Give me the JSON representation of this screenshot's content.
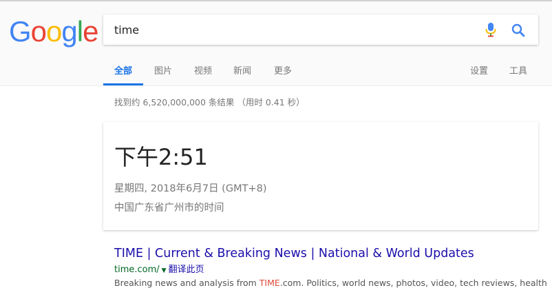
{
  "logo": {
    "letters": [
      {
        "char": "G",
        "color": "#4285F4"
      },
      {
        "char": "o",
        "color": "#EA4335"
      },
      {
        "char": "o",
        "color": "#FBBC05"
      },
      {
        "char": "g",
        "color": "#4285F4"
      },
      {
        "char": "l",
        "color": "#34A853"
      },
      {
        "char": "e",
        "color": "#EA4335"
      }
    ]
  },
  "search": {
    "query": "time"
  },
  "tabs": {
    "all": "全部",
    "images": "图片",
    "videos": "视频",
    "news": "新闻",
    "more": "更多",
    "settings": "设置",
    "tools": "工具"
  },
  "stats": {
    "text": "找到约 6,520,000,000 条结果 （用时 0.41 秒）"
  },
  "time_card": {
    "time": "下午2:51",
    "date": "星期四, 2018年6月7日 (GMT+8)",
    "location": "中国广东省广州市的时间"
  },
  "result": {
    "title": "TIME | Current & Breaking News | National & World Updates",
    "url": "time.com/",
    "dropdown": "▼",
    "translate": "翻译此页",
    "snippet_before": "Breaking news and analysis from ",
    "snippet_highlight": "TIME",
    "snippet_after": ".com. Politics, world news, photos, video, tech reviews, health"
  },
  "colors": {
    "accent": "#1a73e8",
    "link": "#1a0dab",
    "url_green": "#006621",
    "mic_blue": "#4285F4",
    "mic_red": "#EA4335",
    "mic_yellow": "#FBBC05",
    "mic_green": "#34A853"
  }
}
